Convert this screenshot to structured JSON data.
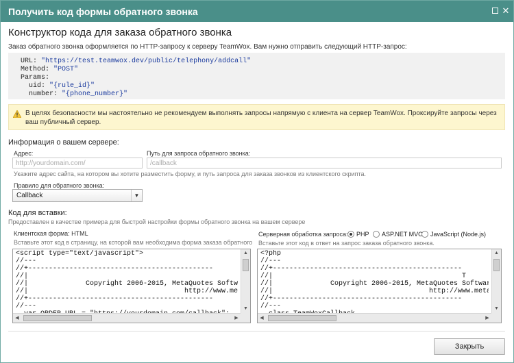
{
  "window": {
    "title": "Получить код формы обратного звонка"
  },
  "heading": "Конструктор кода для заказа обратного звонка",
  "intro": "Заказ обратного звонка оформляется по HTTP-запросу к серверу TeamWox. Вам нужно отправить следующий HTTP-запрос:",
  "request": {
    "url_key": "URL:",
    "url_value": "\"https://test.teamwox.dev/public/telephony/addcall\"",
    "method_key": "Method:",
    "method_value": "\"POST\"",
    "params_key": "Params:",
    "uid_key": "uid:",
    "uid_value": "\"{rule_id}\"",
    "number_key": "number:",
    "number_value": "\"{phone_number}\""
  },
  "warning": {
    "icon": "warning-icon",
    "text": "В целях безопасности мы настоятельно не рекомендуем выполнять запросы напрямую с клиента на сервер TeamWox. Проксируйте запросы через ваш публичный сервер."
  },
  "server_info": {
    "title": "Информация о вашем сервере:",
    "address_label": "Адрес:",
    "address_placeholder": "http://yourdomain.com/",
    "path_label": "Путь для запроса обратного звонка:",
    "path_placeholder": "/callback",
    "hint": "Укажите адрес сайта, на котором вы хотите разместить форму, и путь запроса для заказа звонков из клиентского скрипта.",
    "rule_label": "Правило для обратного звонка:",
    "rule_value": "Callback"
  },
  "embed": {
    "title": "Код для вставки:",
    "hint": "Предоставлен в качестве примера для быстрой настройки формы обратного звонка на вашем сервере",
    "client_label": "Клиентская форма: HTML",
    "client_hint": "Вставьте этот код в страницу, на которой вам необходима форма заказа обратного",
    "server_label": "Серверная обработка запроса:",
    "server_hint": "Вставьте этот код в ответ на запрос заказа обратного звонка.",
    "options": [
      {
        "label": "PHP",
        "selected": true
      },
      {
        "label": "ASP.NET MVC",
        "selected": false
      },
      {
        "label": "JavaScript (Node.js)",
        "selected": false
      }
    ],
    "client_code": "<script type=\"text/javascript\">\n//---\n//+---------------------------------------------\n//|\n//|              Copyright 2006-2015, MetaQuotes Softwar\n//|                                      http://www.metaquo\n//+---------------------------------------------\n//---\n  var ORDER_URL = \"https://yourdomain.com/callback\";",
    "server_code": "<?php\n//---\n//+----------------------------------------------\n//|                                              T\n//|              Copyright 2006-2015, MetaQuotes Software\n//|                                      http://www.metaquo\n//+----------------------------------------------\n//---\n  class TeamWoxCallback"
  },
  "footer": {
    "close_label": "Закрыть"
  }
}
